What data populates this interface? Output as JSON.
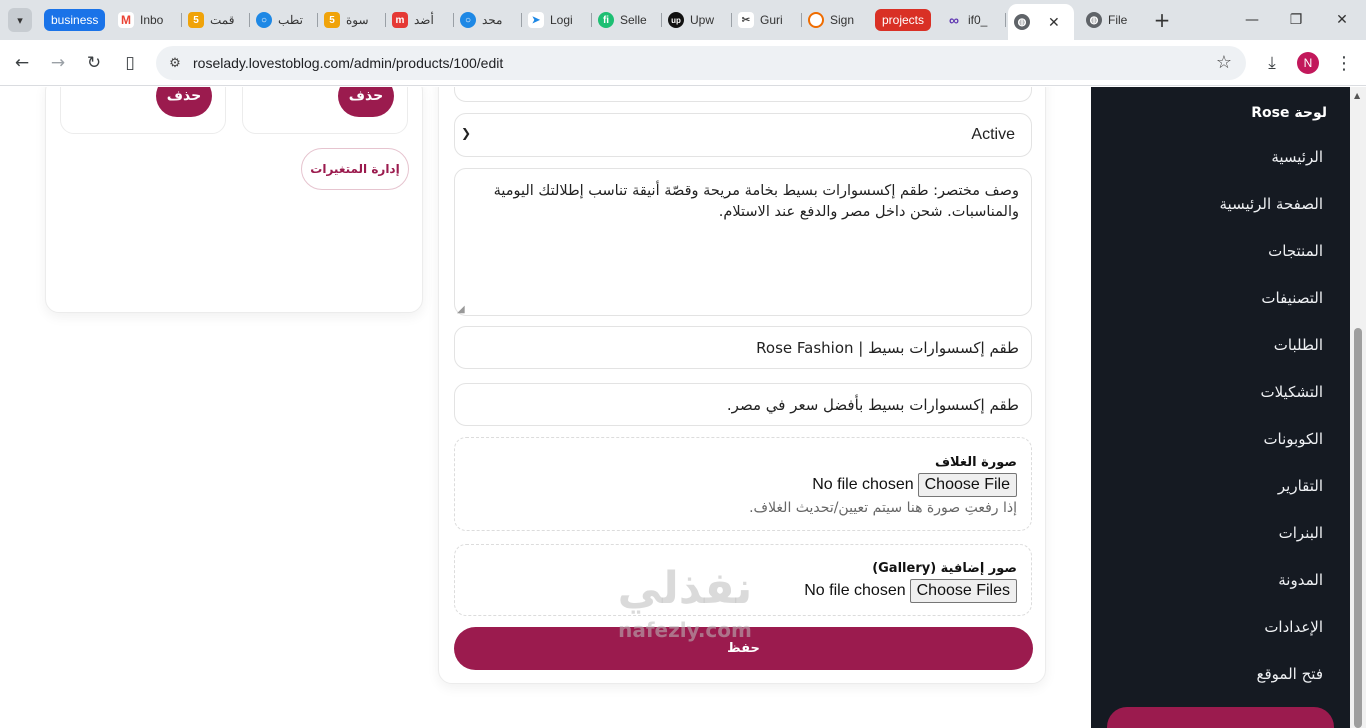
{
  "browser": {
    "tabs": [
      {
        "label": "Inbo",
        "icon": "gmail-icon",
        "color": "#ea4335"
      },
      {
        "label": "قمت",
        "icon": "five-icon",
        "color": "#f0a30a"
      },
      {
        "label": "تطب",
        "icon": "circle-icon",
        "color": "#1e88e5"
      },
      {
        "label": "سوة",
        "icon": "five-icon",
        "color": "#f0a30a"
      },
      {
        "label": "أضد",
        "icon": "mostaql-icon",
        "color": "#e53935"
      },
      {
        "label": "محد",
        "icon": "circle-icon",
        "color": "#1e88e5"
      },
      {
        "label": "Logi",
        "icon": "arrow-icon",
        "color": "#1e88e5"
      },
      {
        "label": "Selle",
        "icon": "fiverr-icon",
        "color": "#1dbf73"
      },
      {
        "label": "Upw",
        "icon": "upwork-icon",
        "color": "#111111"
      },
      {
        "label": "Guri",
        "icon": "tools-icon",
        "color": "#444444"
      },
      {
        "label": "Sign",
        "icon": "ring-icon",
        "color": "#ef6c00"
      },
      {
        "label": "if0_",
        "icon": "infinity-icon",
        "color": "#5e35b1"
      },
      {
        "label": "File",
        "icon": "globe-icon",
        "color": "#5f6368"
      }
    ],
    "pill_business": "business",
    "pill_projects": "projects",
    "business_color": "#1a73e8",
    "projects_color": "#d93025",
    "url": "roselady.lovestoblog.com/admin/products/100/edit",
    "profile_initial": "N"
  },
  "left_panel": {
    "delete_label": "حذف",
    "manage_variants_label": "إدارة المتغيرات"
  },
  "form": {
    "status_value": "Active",
    "description": "وصف مختصر: طقم إكسسوارات بسيط بخامة مريحة وقصّة أنيقة تناسب إطلالتك اليومية والمناسبات. شحن داخل مصر والدفع عند الاستلام.",
    "meta_title": "طقم إكسسوارات بسيط | Rose Fashion",
    "meta_description": "طقم إكسسوارات بسيط بأفضل سعر في مصر.",
    "cover_label": "صورة الغلاف",
    "cover_button": "Choose File",
    "cover_status": "No file chosen",
    "cover_hint": "إذا رفعتِ صورة هنا سيتم تعيين/تحديث الغلاف.",
    "gallery_label": "صور إضافية (Gallery)",
    "gallery_button": "Choose Files",
    "gallery_status": "No file chosen",
    "save_label": "حفظ"
  },
  "sidebar": {
    "brand": "لوحة Rose",
    "items": [
      "الرئيسية",
      "الصفحة الرئيسية",
      "المنتجات",
      "التصنيفات",
      "الطلبات",
      "التشكيلات",
      "الكوبونات",
      "التقارير",
      "البنرات",
      "المدونة",
      "الإعدادات",
      "فتح الموقع"
    ]
  },
  "watermark": {
    "logo_text": "نفذلي",
    "site_text": "nafezly.com"
  },
  "colors": {
    "primary": "#9b1b4e",
    "sidebar_bg": "#151a22"
  }
}
